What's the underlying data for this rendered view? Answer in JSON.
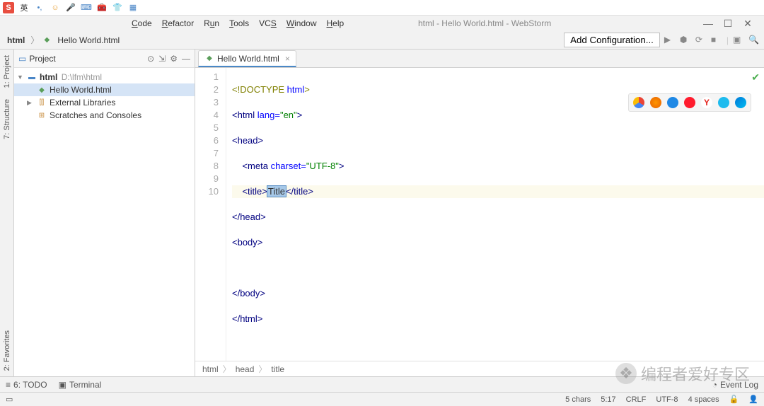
{
  "ime": {
    "lang": "英"
  },
  "menu": {
    "code": "Code",
    "refactor": "Refactor",
    "run": "Run",
    "tools": "Tools",
    "vcs": "VCS",
    "window": "Window",
    "help": "Help"
  },
  "window_title": "html - Hello World.html - WebStorm",
  "breadcrumb": {
    "root": "html",
    "file": "Hello World.html"
  },
  "toolbar": {
    "add_config": "Add Configuration..."
  },
  "project": {
    "title": "Project",
    "root": {
      "name": "html",
      "path": "D:\\lfm\\html"
    },
    "file": "Hello World.html",
    "ext_libs": "External Libraries",
    "scratches": "Scratches and Consoles"
  },
  "side_tabs": {
    "project": "1: Project",
    "structure": "7: Structure",
    "favorites": "2: Favorites"
  },
  "editor": {
    "tab_name": "Hello World.html",
    "lines": [
      {
        "n": 1,
        "raw": "<!DOCTYPE html>"
      },
      {
        "n": 2,
        "raw": "<html lang=\"en\">"
      },
      {
        "n": 3,
        "raw": "<head>"
      },
      {
        "n": 4,
        "raw": "    <meta charset=\"UTF-8\">"
      },
      {
        "n": 5,
        "raw": "    <title>Title</title>",
        "sel": "Title"
      },
      {
        "n": 6,
        "raw": "</head>"
      },
      {
        "n": 7,
        "raw": "<body>"
      },
      {
        "n": 8,
        "raw": ""
      },
      {
        "n": 9,
        "raw": "</body>"
      },
      {
        "n": 10,
        "raw": "</html>"
      }
    ],
    "crumb": [
      "html",
      "head",
      "title"
    ]
  },
  "browsers": [
    "chrome",
    "firefox",
    "safari",
    "opera",
    "yandex",
    "ie",
    "edge"
  ],
  "bottom": {
    "todo": "6: TODO",
    "terminal": "Terminal",
    "event_log": "Event Log"
  },
  "status": {
    "chars": "5 chars",
    "pos": "5:17",
    "le": "CRLF",
    "enc": "UTF-8",
    "indent": "4 spaces"
  },
  "watermark": "编程者爱好专区"
}
